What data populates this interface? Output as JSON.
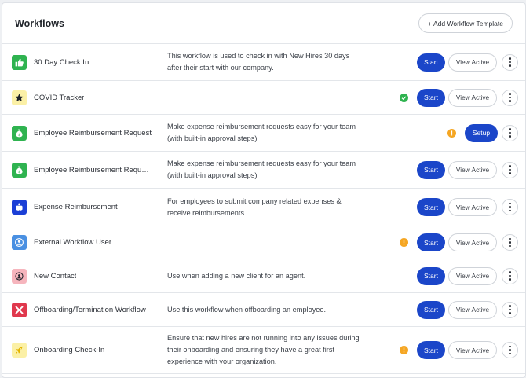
{
  "header": {
    "title": "Workflows",
    "add_template_label": "+ Add Workflow Template"
  },
  "rows": [
    {
      "name": "30 Day Check In",
      "description": "This workflow is used to check in with New Hires 30 days after their start with our company.",
      "icon": "thumbs-up-icon",
      "icon_bg": "#2fb350",
      "status": "",
      "primary_label": "Start",
      "secondary_label": "View Active"
    },
    {
      "name": "COVID Tracker",
      "description": "",
      "icon": "star-icon",
      "icon_bg": "#fbf0a6",
      "status": "check",
      "primary_label": "Start",
      "secondary_label": "View Active"
    },
    {
      "name": "Employee Reimbursement Request",
      "description": "Make expense reimbursement requests easy for your team (with built-in approval steps)",
      "icon": "money-bag-icon",
      "icon_bg": "#2fb350",
      "status": "warning",
      "primary_label": "Setup",
      "secondary_label": ""
    },
    {
      "name": "Employee Reimbursement Request ...",
      "description": "Make expense reimbursement requests easy for your team (with built-in approval steps)",
      "icon": "money-bag-icon",
      "icon_bg": "#2fb350",
      "status": "",
      "primary_label": "Start",
      "secondary_label": "View Active"
    },
    {
      "name": "Expense Reimbursement",
      "description": "For employees to submit company related expenses & receive reimbursements.",
      "icon": "piggy-bank-icon",
      "icon_bg": "#1b3fd6",
      "status": "",
      "primary_label": "Start",
      "secondary_label": "View Active"
    },
    {
      "name": "External Workflow User",
      "description": "",
      "icon": "user-circle-icon",
      "icon_bg": "#4a90e2",
      "status": "warning",
      "primary_label": "Start",
      "secondary_label": "View Active"
    },
    {
      "name": "New Contact",
      "description": "Use when adding a new client for an agent.",
      "icon": "contact-icon",
      "icon_bg": "#f6b5bd",
      "status": "",
      "primary_label": "Start",
      "secondary_label": "View Active"
    },
    {
      "name": "Offboarding/Termination Workflow",
      "description": "Use this workflow when offboarding an employee.",
      "icon": "x-mark-icon",
      "icon_bg": "#e0384d",
      "status": "",
      "primary_label": "Start",
      "secondary_label": "View Active"
    },
    {
      "name": "Onboarding Check-In",
      "description": "Ensure that new hires are not running into any issues during their onboarding and ensuring they have a great first experience with your organization.",
      "icon": "rocket-icon",
      "icon_bg": "#fbf0a6",
      "status": "warning",
      "primary_label": "Start",
      "secondary_label": "View Active"
    }
  ],
  "colors": {
    "primary": "#1b46c9",
    "success": "#2fb350",
    "warning": "#f5a623"
  }
}
